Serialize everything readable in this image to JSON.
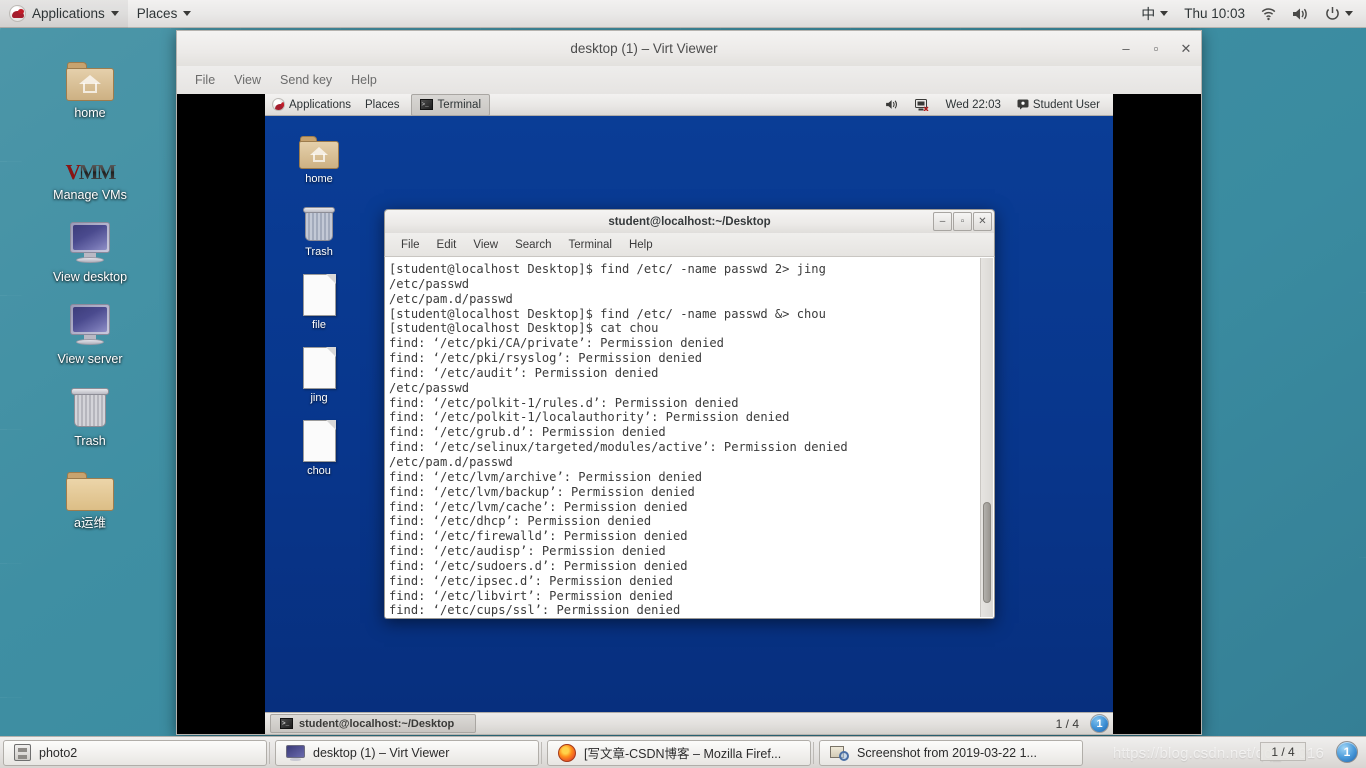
{
  "host": {
    "top_panel": {
      "logo_icon": "redhat-logo-icon",
      "applications_label": "Applications",
      "places_label": "Places",
      "ime_label": "中",
      "clock": "Thu 10:03",
      "wifi_icon": "wifi-icon",
      "volume_icon": "volume-icon",
      "power_icon": "power-icon"
    },
    "desktop_icons": [
      {
        "label": "home",
        "icon": "folder-home-icon"
      },
      {
        "label": "Manage VMs",
        "icon": "vmm-logo-icon"
      },
      {
        "label": "View desktop",
        "icon": "monitor-icon"
      },
      {
        "label": "View server",
        "icon": "monitor-icon"
      },
      {
        "label": "Trash",
        "icon": "trash-icon"
      },
      {
        "label": "a运维",
        "icon": "folder-icon"
      }
    ],
    "taskbar": {
      "buttons": [
        {
          "label": "photo2",
          "icon": "archive-icon"
        },
        {
          "label": "desktop (1) – Virt Viewer",
          "icon": "monitor-icon"
        },
        {
          "label": "[写文章-CSDN博客 – Mozilla Firef...",
          "icon": "firefox-icon"
        },
        {
          "label": "Screenshot from 2019-03-22 1...",
          "icon": "screenshot-icon"
        }
      ],
      "workspace_count": "1 / 4",
      "workspace_current": "1",
      "watermark": "https://blog.csdn.net/qq_36016"
    }
  },
  "virt_viewer": {
    "title": "desktop (1) – Virt Viewer",
    "window_controls": {
      "minimize": "–",
      "maximize": "▫",
      "close": "✕"
    },
    "menus": [
      "File",
      "View",
      "Send key",
      "Help"
    ]
  },
  "guest": {
    "top_panel": {
      "applications_label": "Applications",
      "places_label": "Places",
      "active_task": "Terminal",
      "volume_icon": "volume-icon",
      "network_icon": "network-disconnected-icon",
      "clock": "Wed 22:03",
      "user_icon": "user-icon",
      "user_label": "Student User"
    },
    "desktop_icons": [
      {
        "label": "home",
        "icon": "folder-home-icon"
      },
      {
        "label": "Trash",
        "icon": "trash-icon"
      },
      {
        "label": "file",
        "icon": "document-icon"
      },
      {
        "label": "jing",
        "icon": "document-icon"
      },
      {
        "label": "chou",
        "icon": "document-icon"
      }
    ],
    "bottom_panel": {
      "task_label": "student@localhost:~/Desktop",
      "task_icon": "terminal-icon",
      "workspace_count": "1 / 4",
      "workspace_current": "1"
    }
  },
  "terminal": {
    "title": "student@localhost:~/Desktop",
    "window_controls": {
      "minimize": "–",
      "maximize": "▫",
      "close": "✕"
    },
    "menus": [
      "File",
      "Edit",
      "View",
      "Search",
      "Terminal",
      "Help"
    ],
    "lines": [
      "[student@localhost Desktop]$ find /etc/ -name passwd 2> jing",
      "/etc/passwd",
      "/etc/pam.d/passwd",
      "[student@localhost Desktop]$ find /etc/ -name passwd &> chou",
      "[student@localhost Desktop]$ cat chou",
      "find: ‘/etc/pki/CA/private’: Permission denied",
      "find: ‘/etc/pki/rsyslog’: Permission denied",
      "find: ‘/etc/audit’: Permission denied",
      "/etc/passwd",
      "find: ‘/etc/polkit-1/rules.d’: Permission denied",
      "find: ‘/etc/polkit-1/localauthority’: Permission denied",
      "find: ‘/etc/grub.d’: Permission denied",
      "find: ‘/etc/selinux/targeted/modules/active’: Permission denied",
      "/etc/pam.d/passwd",
      "find: ‘/etc/lvm/archive’: Permission denied",
      "find: ‘/etc/lvm/backup’: Permission denied",
      "find: ‘/etc/lvm/cache’: Permission denied",
      "find: ‘/etc/dhcp’: Permission denied",
      "find: ‘/etc/firewalld’: Permission denied",
      "find: ‘/etc/audisp’: Permission denied",
      "find: ‘/etc/sudoers.d’: Permission denied",
      "find: ‘/etc/ipsec.d’: Permission denied",
      "find: ‘/etc/libvirt’: Permission denied",
      "find: ‘/etc/cups/ssl’: Permission denied"
    ]
  },
  "colors": {
    "host_desktop": "#3f8fa3",
    "guest_desktop": "#08368c",
    "terminal_bg": "#ffffff",
    "terminal_fg": "#3b3b3b",
    "accent_blue": "#3d8fd4"
  }
}
